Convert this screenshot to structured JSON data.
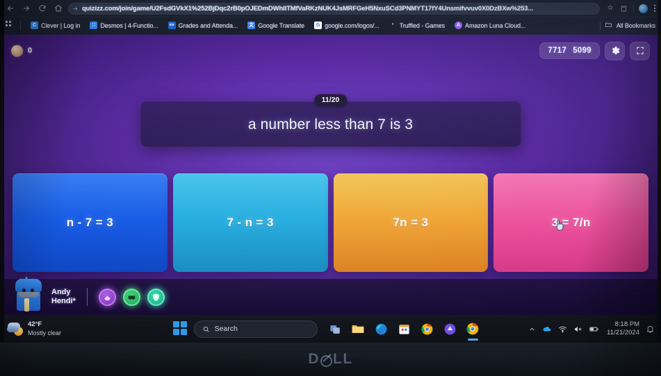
{
  "browser": {
    "nav": {
      "back_icon": "back-arrow-icon",
      "forward_icon": "forward-arrow-icon",
      "reload_icon": "reload-icon",
      "home_icon": "home-icon"
    },
    "omnibox": {
      "url": "quizizz.com/join/game/U2FsdGVkX1%252BjDqc2rB0pOJEDmDWhlITMfVaRKzNUK4JsMRFGeH5NxuSCd3PNMYT17fY4Unsmifvvuv0X0DzBXw%253...",
      "star_glyph": "☆",
      "star_icon": "bookmark-star-icon",
      "share_icon": "share-icon"
    },
    "toolbar": {
      "cast_icon": "cast-icon",
      "profile_icon": "profile-avatar-icon",
      "menu_icon": "kebab-menu-icon"
    },
    "bookmarks": {
      "apps_icon": "apps-grid-icon",
      "items": [
        {
          "label": "Clever | Log in",
          "fav_letter": "C",
          "fav_color": "#2e7fd6"
        },
        {
          "label": "Desmos | 4-Functio...",
          "fav_letter": "∷",
          "fav_color": "#2f7de0"
        },
        {
          "label": "Grades and Attenda...",
          "fav_letter": "sis",
          "fav_color": "#1d5fc4"
        },
        {
          "label": "Google Translate",
          "fav_letter": "文",
          "fav_color": "#3b7de8"
        },
        {
          "label": "google.com/logos/...",
          "fav_letter": "G",
          "fav_color": "#2a6fd8"
        },
        {
          "label": "Truffled - Games",
          "fav_letter": "*",
          "fav_color": "#2a3246"
        },
        {
          "label": "Amazon Luna Cloud...",
          "fav_letter": "A",
          "fav_color": "#8a5ee8"
        }
      ],
      "all_bookmarks_label": "All Bookmarks",
      "all_bookmarks_icon": "folder-icon"
    }
  },
  "game": {
    "streak": {
      "count": "0",
      "icon": "streak-coin-icon"
    },
    "scores": {
      "left": "7717",
      "right": "5099"
    },
    "settings_icon": "gear-icon",
    "fullscreen_icon": "fullscreen-icon",
    "question": {
      "counter": "11/20",
      "text": "a number less than 7 is 3"
    },
    "answers": [
      {
        "label": "n - 7 = 3",
        "color": "#1157e4",
        "key": "a"
      },
      {
        "label": "7 - n = 3",
        "color": "#1fa8dd",
        "key": "b"
      },
      {
        "label": "7n = 3",
        "color": "#ef9f2e",
        "key": "c"
      },
      {
        "label": "3 = 7/n",
        "color": "#ec4c9c",
        "key": "d"
      }
    ],
    "player": {
      "name": "Andy\nHendi*",
      "avatar_icon": "player-avatar-icon",
      "powerups": [
        {
          "name": "powerup-eraser",
          "icon": "eraser-powerup-icon",
          "color": "#a95fe0"
        },
        {
          "name": "powerup-double-jeopardy",
          "icon": "mask-powerup-icon",
          "color": "#3fd17a"
        },
        {
          "name": "powerup-immunity",
          "icon": "shield-powerup-icon",
          "color": "#35d4a0"
        }
      ]
    }
  },
  "taskbar": {
    "weather": {
      "temperature": "42°F",
      "condition": "Mostly clear",
      "icon": "weather-partly-cloudy-night-icon"
    },
    "start_icon": "windows-start-icon",
    "search": {
      "placeholder": "Search",
      "icon": "search-icon"
    },
    "apps": [
      {
        "name": "task-view-icon",
        "label": "Task View"
      },
      {
        "name": "file-explorer-icon",
        "label": "File Explorer"
      },
      {
        "name": "microsoft-edge-icon",
        "label": "Microsoft Edge"
      },
      {
        "name": "microsoft-store-icon",
        "label": "Microsoft Store"
      },
      {
        "name": "google-chrome-icon",
        "label": "Google Chrome"
      },
      {
        "name": "amazon-luna-icon",
        "label": "Amazon Luna"
      },
      {
        "name": "google-chrome-active-icon",
        "label": "Google Chrome"
      }
    ],
    "tray": {
      "chevron_icon": "show-hidden-icons-chevron",
      "onedrive_icon": "onedrive-icon",
      "wifi_icon": "wifi-icon",
      "volume_icon": "volume-muted-icon",
      "battery_icon": "battery-icon",
      "time": "8:18 PM",
      "date": "11/21/2024",
      "notifications_icon": "notification-bell-icon"
    }
  },
  "monitor": {
    "brand": "D",
    "brand_tail": "LL"
  }
}
